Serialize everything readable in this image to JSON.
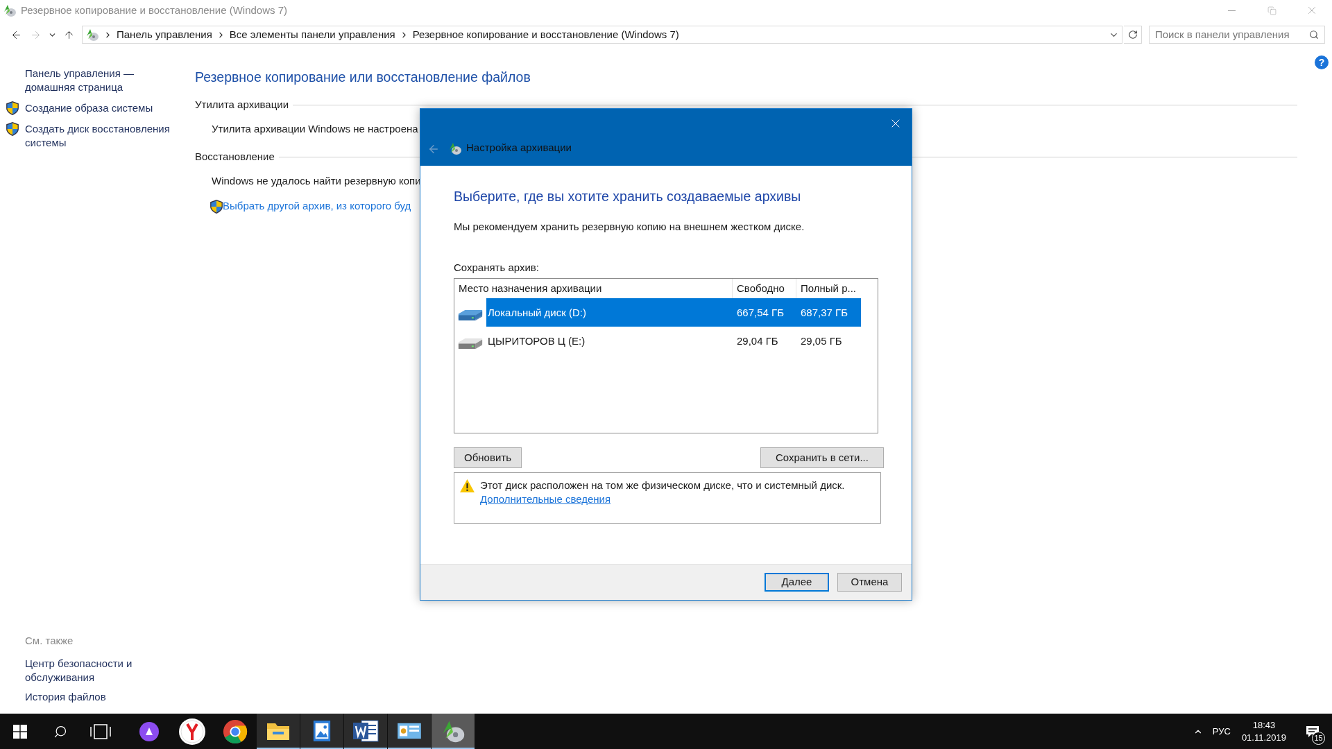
{
  "window": {
    "title": "Резервное копирование и восстановление (Windows 7)"
  },
  "address_bar": {
    "breadcrumbs": [
      "Панель управления",
      "Все элементы панели управления",
      "Резервное копирование и восстановление (Windows 7)"
    ]
  },
  "search": {
    "placeholder": "Поиск в панели управления"
  },
  "help": "?",
  "sidebar": {
    "items": [
      {
        "label": "Панель управления —\nдомашняя страница",
        "shield": false
      },
      {
        "label": "Создание образа системы",
        "shield": true
      },
      {
        "label": "Создать диск восстановления\nсистемы",
        "shield": true
      }
    ],
    "see_also": {
      "heading": "См. также",
      "items": [
        "Центр безопасности и\nобслуживания",
        "История файлов"
      ]
    }
  },
  "main": {
    "title": "Резервное копирование или восстановление файлов",
    "sections": [
      {
        "heading": "Утилита архивации",
        "lines": [
          {
            "kind": "text",
            "text": "Утилита архивации Windows не настроена"
          }
        ]
      },
      {
        "heading": "Восстановление",
        "lines": [
          {
            "kind": "text",
            "text": "Windows не удалось найти резервную копи"
          },
          {
            "kind": "shield-link",
            "text": "Выбрать другой архив, из которого буд"
          }
        ]
      }
    ]
  },
  "dialog": {
    "title": "Настройка архивации",
    "heading": "Выберите, где вы хотите хранить создаваемые архивы",
    "description": "Мы рекомендуем хранить резервную копию на внешнем жестком диске.",
    "list_label": "Сохранять архив:",
    "columns": [
      "Место назначения архивации",
      "Свободно",
      "Полный р..."
    ],
    "rows": [
      {
        "kind": "local",
        "name": "Локальный диск (D:)",
        "free": "667,54 ГБ",
        "total": "687,37 ГБ",
        "selected": true
      },
      {
        "kind": "usb",
        "name": "ЦЫРИТОРОВ Ц (E:)",
        "free": "29,04 ГБ",
        "total": "29,05 ГБ",
        "selected": false
      }
    ],
    "refresh_button": "Обновить",
    "network_button": "Сохранить в сети...",
    "warning": {
      "text": "Этот диск расположен на том же физическом диске, что и системный диск.",
      "link": "Дополнительные сведения"
    },
    "footer_buttons": [
      {
        "label": "Далее",
        "default": true
      },
      {
        "label": "Отмена",
        "default": false
      }
    ]
  },
  "taskbar": {
    "apps": [
      {
        "kind": "alice",
        "running": false,
        "selected": false
      },
      {
        "kind": "yandex",
        "running": false,
        "selected": false
      },
      {
        "kind": "chrome",
        "running": false,
        "selected": false
      },
      {
        "kind": "explorer",
        "running": true,
        "selected": false
      },
      {
        "kind": "photos",
        "running": true,
        "selected": false
      },
      {
        "kind": "word",
        "running": true,
        "selected": false
      },
      {
        "kind": "panel",
        "running": true,
        "selected": false
      },
      {
        "kind": "backup",
        "running": true,
        "selected": true
      }
    ],
    "language": "РУС",
    "time": "18:43",
    "date": "01.11.2019",
    "notifications": "15"
  }
}
